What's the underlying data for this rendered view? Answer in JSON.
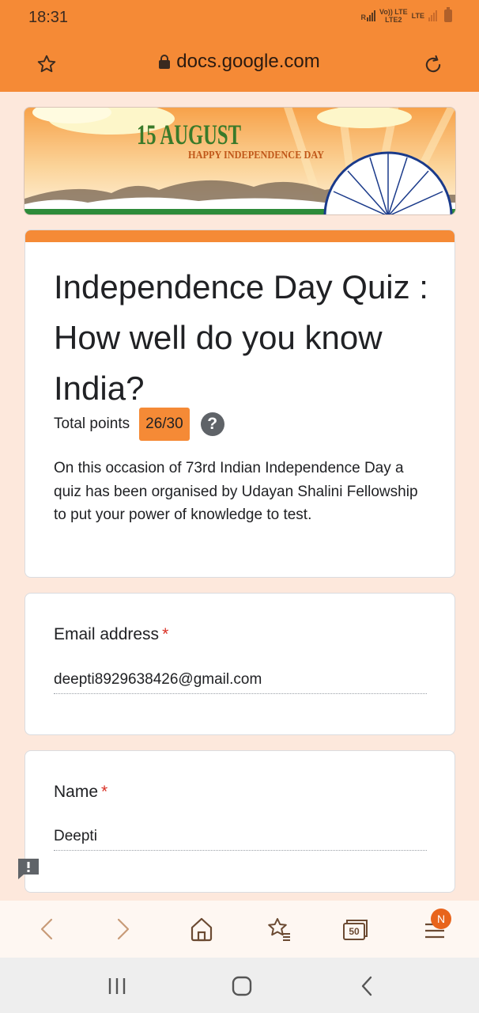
{
  "status_bar": {
    "time": "18:31",
    "signal_labels": [
      "R",
      "Vo)) LTE",
      "LTE2",
      "LTE"
    ],
    "icons": [
      "signal-icon",
      "signal-icon",
      "battery-icon"
    ]
  },
  "browser": {
    "url": "docs.google.com",
    "icons": [
      "star-icon",
      "lock-icon",
      "reload-icon"
    ],
    "nav": {
      "tabs_count": "50",
      "notification_badge": "N",
      "icons": [
        "back-icon",
        "forward-icon",
        "home-icon",
        "bookmarks-icon",
        "tabs-icon",
        "menu-icon"
      ]
    }
  },
  "banner": {
    "title": "15 AUGUST",
    "subtitle": "HAPPY INDEPENDENCE DAY"
  },
  "form": {
    "title": "Independence Day Quiz : How well do you know India?",
    "points_label": "Total points",
    "points_value": "26/30",
    "description": "On this occasion of  73rd Indian Independence Day a quiz has been organised by Udayan Shalini Fellowship to put your power of knowledge to test.",
    "questions": [
      {
        "label": "Email address",
        "required_mark": "*",
        "answer": "deepti8929638426@gmail.com"
      },
      {
        "label": "Name",
        "required_mark": "*",
        "answer": "Deepti"
      }
    ]
  },
  "colors": {
    "accent": "#f58a36",
    "page_background": "#fde8dc",
    "required": "#d93025",
    "card": "#ffffff"
  }
}
